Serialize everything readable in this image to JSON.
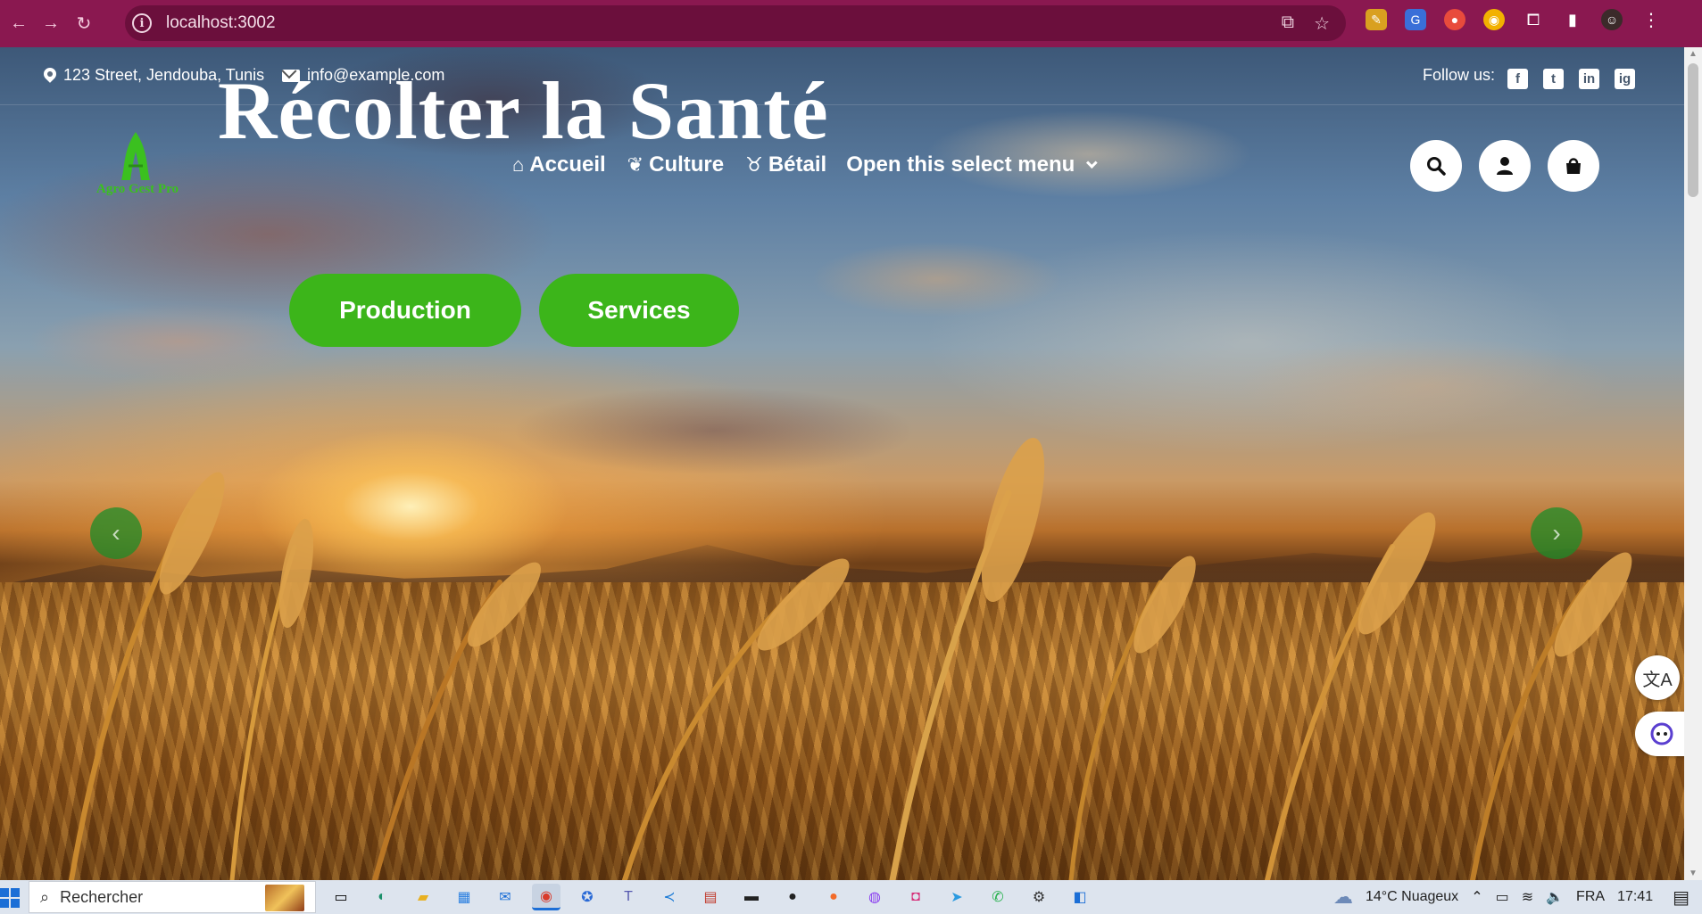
{
  "browser": {
    "url": "localhost:3002",
    "back_icon": "arrow-left-icon",
    "forward_icon": "arrow-right-icon",
    "reload_icon": "reload-icon"
  },
  "topbar": {
    "address": "123 Street, Jendouba, Tunis",
    "email": "info@example.com",
    "follow_label": "Follow us:",
    "socials": [
      "f",
      "t",
      "in",
      "ig"
    ]
  },
  "hero": {
    "title": "Récolter la Santé"
  },
  "logo": {
    "text": "Agro Gest Pro"
  },
  "nav": {
    "items": [
      {
        "label": "Accueil",
        "icon": "home-icon"
      },
      {
        "label": "Culture",
        "icon": "leaf-icon"
      },
      {
        "label": "Bétail",
        "icon": "cow-icon"
      }
    ],
    "select_label": "Open this select menu"
  },
  "cta": {
    "production": "Production",
    "services": "Services"
  },
  "carousel": {
    "prev": "‹",
    "next": "›"
  },
  "taskbar": {
    "search_placeholder": "Rechercher",
    "weather": "14°C  Nuageux",
    "language": "FRA",
    "time": "17:41"
  },
  "colors": {
    "chrome": "#8a1850",
    "accent_green": "#3cb51a",
    "logo_green": "#3bc01f"
  }
}
